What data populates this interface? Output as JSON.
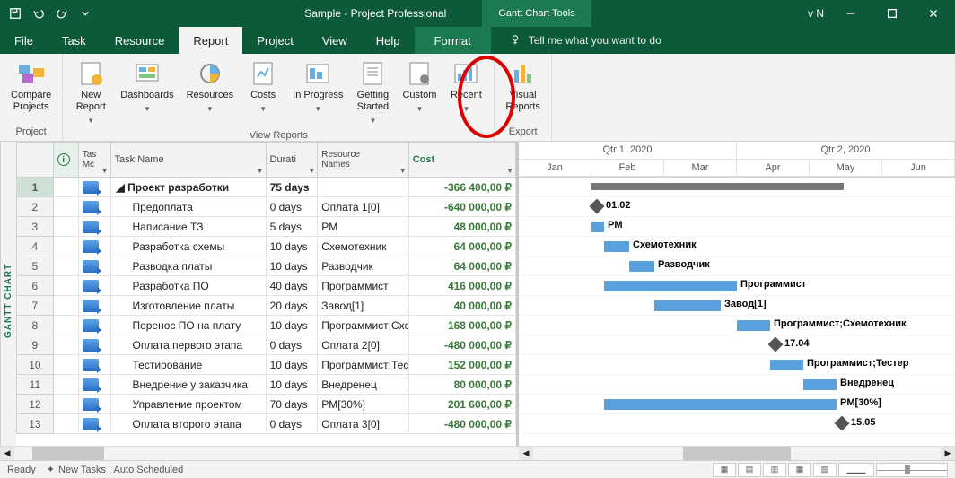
{
  "titlebar": {
    "doc_title": "Sample  -  Project Professional",
    "tool_context": "Gantt Chart Tools",
    "vn": "v N"
  },
  "menu": {
    "file": "File",
    "task": "Task",
    "resource": "Resource",
    "report": "Report",
    "project": "Project",
    "view": "View",
    "help": "Help",
    "format": "Format",
    "tellme": "Tell me what you want to do"
  },
  "ribbon": {
    "compare": "Compare\nProjects",
    "project_group": "Project",
    "newreport": "New\nReport",
    "dashboards": "Dashboards",
    "resources": "Resources",
    "costs": "Costs",
    "inprogress": "In Progress",
    "getting": "Getting\nStarted",
    "custom": "Custom",
    "recent": "Recent",
    "viewreports_group": "View Reports",
    "visual": "Visual\nReports",
    "export_group": "Export"
  },
  "grid": {
    "headers": {
      "mode": "Tas\nMc",
      "name": "Task Name",
      "duration": "Durati",
      "resources": "Resource\nNames",
      "cost": "Cost"
    },
    "rows": [
      {
        "num": "1",
        "name": "Проект разработки",
        "indent": 0,
        "dur": "75 days",
        "res": "",
        "cost": "-366 400,00 ₽",
        "summary": true,
        "selected": true
      },
      {
        "num": "2",
        "name": "Предоплата",
        "indent": 1,
        "dur": "0 days",
        "res": "Оплата 1[0]",
        "cost": "-640 000,00 ₽"
      },
      {
        "num": "3",
        "name": "Написание ТЗ",
        "indent": 1,
        "dur": "5 days",
        "res": "PM",
        "cost": "48 000,00 ₽"
      },
      {
        "num": "4",
        "name": "Разработка схемы",
        "indent": 1,
        "dur": "10 days",
        "res": "Схемотехник",
        "cost": "64 000,00 ₽"
      },
      {
        "num": "5",
        "name": "Разводка платы",
        "indent": 1,
        "dur": "10 days",
        "res": "Разводчик",
        "cost": "64 000,00 ₽"
      },
      {
        "num": "6",
        "name": "Разработка ПО",
        "indent": 1,
        "dur": "40 days",
        "res": "Программист",
        "cost": "416 000,00 ₽"
      },
      {
        "num": "7",
        "name": "Изготовление платы",
        "indent": 1,
        "dur": "20 days",
        "res": "Завод[1]",
        "cost": "40 000,00 ₽"
      },
      {
        "num": "8",
        "name": "Перенос ПО на плату",
        "indent": 1,
        "dur": "10 days",
        "res": "Программист;Схемотехник",
        "cost": "168 000,00 ₽"
      },
      {
        "num": "9",
        "name": "Оплата первого этапа",
        "indent": 1,
        "dur": "0 days",
        "res": "Оплата 2[0]",
        "cost": "-480 000,00 ₽"
      },
      {
        "num": "10",
        "name": "Тестирование",
        "indent": 1,
        "dur": "10 days",
        "res": "Программист;Тестер",
        "cost": "152 000,00 ₽"
      },
      {
        "num": "11",
        "name": "Внедрение у заказчика",
        "indent": 1,
        "dur": "10 days",
        "res": "Внедренец",
        "cost": "80 000,00 ₽"
      },
      {
        "num": "12",
        "name": "Управление проектом",
        "indent": 1,
        "dur": "70 days",
        "res": "PM[30%]",
        "cost": "201 600,00 ₽"
      },
      {
        "num": "13",
        "name": "Оплата второго этапа",
        "indent": 1,
        "dur": "0 days",
        "res": "Оплата 3[0]",
        "cost": "-480 000,00 ₽"
      }
    ]
  },
  "timeline": {
    "qtr1": "Qtr 1, 2020",
    "qtr2": "Qtr 2, 2020",
    "months": [
      "Jan",
      "Feb",
      "Mar",
      "Apr",
      "May",
      "Jun"
    ]
  },
  "gantt_labels": {
    "r2": "01.02",
    "r3": "PM",
    "r4": "Схемотехник",
    "r5": "Разводчик",
    "r6": "Программист",
    "r7": "Завод[1]",
    "r8": "Программист;Схемотехник",
    "r9": "17.04",
    "r10": "Программист;Тестер",
    "r11": "Внедренец",
    "r12": "PM[30%]",
    "r13": "15.05"
  },
  "sidelabel": "GANTT CHART",
  "status": {
    "ready": "Ready",
    "newtasks": "New Tasks : Auto Scheduled"
  }
}
